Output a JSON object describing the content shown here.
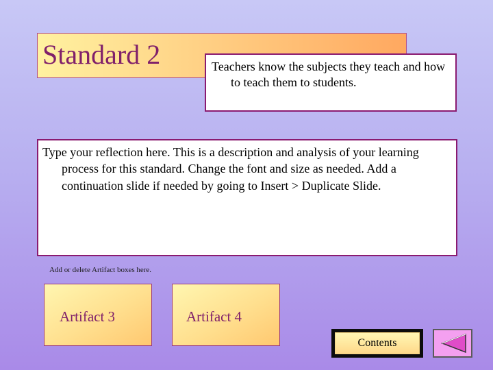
{
  "title": {
    "text": "Standard 2",
    "subtitle": "Teachers know the subjects they teach and how to teach them to students."
  },
  "reflection": {
    "text": "Type your reflection here.  This is a description and analysis of your learning process for this standard.  Change the font and size as needed.  Add a continuation slide if needed by going to Insert > Duplicate Slide."
  },
  "artifacts": {
    "note": "Add or delete Artifact boxes here.",
    "items": [
      {
        "label": "Artifact 3"
      },
      {
        "label": "Artifact 4"
      }
    ]
  },
  "navigation": {
    "contents_label": "Contents",
    "back_icon": "triangle-left-icon"
  },
  "colors": {
    "title_text": "#80206a",
    "box_border": "#8a1a70",
    "back_button_fill": "#f4a0f0"
  }
}
